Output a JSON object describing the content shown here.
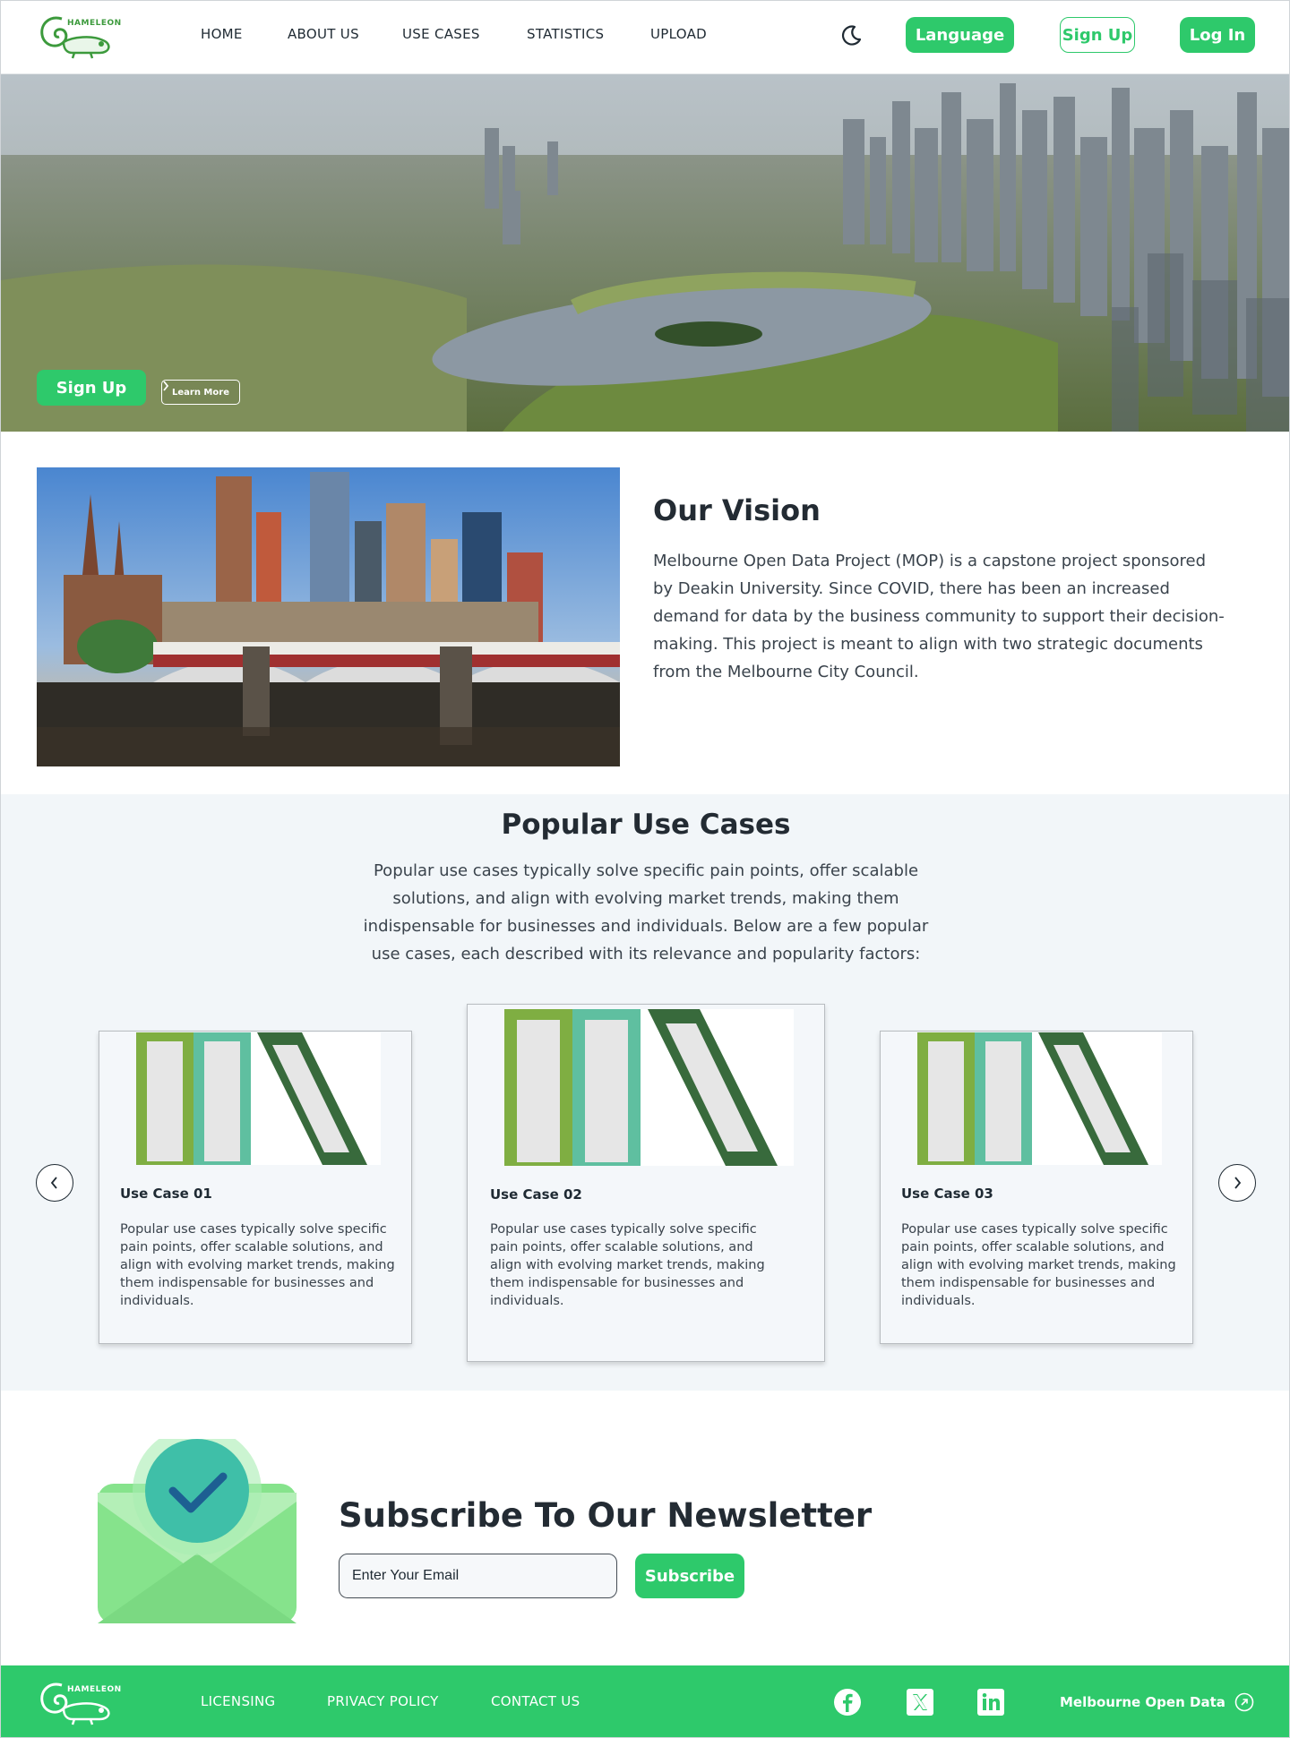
{
  "brand": {
    "logo_text": "HAMELEON"
  },
  "header": {
    "nav": [
      "HOME",
      "ABOUT US",
      "USE CASES",
      "STATISTICS",
      "UPLOAD"
    ],
    "language_label": "Language",
    "signup_label": "Sign Up",
    "login_label": "Log In"
  },
  "hero": {
    "signup_label": "Sign Up",
    "learn_more_label": "Learn More"
  },
  "vision": {
    "title": "Our Vision",
    "text": "Melbourne Open Data Project (MOP) is a capstone project sponsored by Deakin University. Since COVID, there has been an increased demand for data by the business community to support their decision-making. This project is meant to align with two strategic documents from the Melbourne City Council."
  },
  "use_cases": {
    "title": "Popular Use Cases",
    "description": "Popular use cases typically solve specific pain points, offer scalable solutions, and align with evolving market trends, making them indispensable for businesses and individuals. Below are a few popular use cases, each described with its relevance and popularity factors:",
    "cards": [
      {
        "title": "Use Case 01",
        "text": "Popular use cases typically solve specific pain points, offer scalable solutions, and align with evolving market trends, making them indispensable for businesses and individuals."
      },
      {
        "title": "Use Case 02",
        "text": "Popular use cases typically solve specific pain points, offer scalable solutions, and align with evolving market trends, making them indispensable for businesses and individuals."
      },
      {
        "title": "Use Case 03",
        "text": "Popular use cases typically solve specific pain points, offer scalable solutions, and align with evolving market trends, making them indispensable for businesses and individuals."
      }
    ]
  },
  "newsletter": {
    "title": "Subscribe To Our Newsletter",
    "placeholder": "Enter Your Email",
    "button_label": "Subscribe"
  },
  "footer": {
    "links": [
      "LICENSING",
      "PRIVACY POLICY",
      "CONTACT US"
    ],
    "mop_label": "Melbourne Open Data"
  },
  "colors": {
    "accent": "#2ec96b",
    "text_dark": "#232b33",
    "section_bg": "#f2f6f9"
  },
  "icons": [
    "moon-icon",
    "chevron-right-icon",
    "chevron-left-icon",
    "check-icon",
    "facebook-icon",
    "x-icon",
    "linkedin-icon",
    "external-link-icon"
  ]
}
